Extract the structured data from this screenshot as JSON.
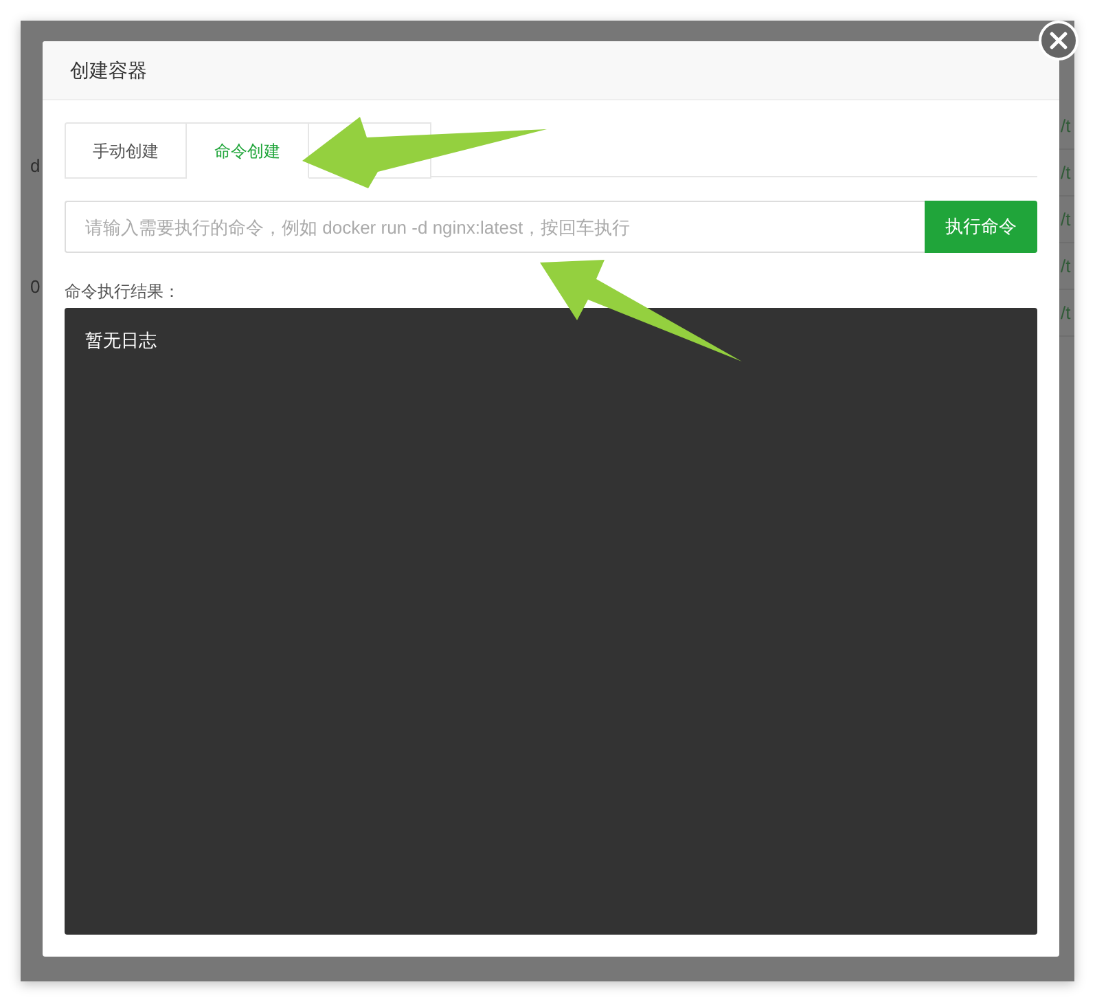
{
  "background_page": {
    "left_column": [
      "d",
      "0"
    ],
    "right_column": [
      "/t",
      "/t",
      "/t",
      "/t",
      "/t"
    ]
  },
  "dialog": {
    "title": "创建容器"
  },
  "tabs": [
    {
      "label": "手动创建",
      "selected": false
    },
    {
      "label": "命令创建",
      "selected": true
    },
    {
      "selected": false
    }
  ],
  "command_field": {
    "placeholder": "请输入需要执行的命令，例如 docker run -d nginx:latest，按回车执行"
  },
  "run_button": "执行命令",
  "result_label": "命令执行结果：",
  "log_output": "暂无日志"
}
